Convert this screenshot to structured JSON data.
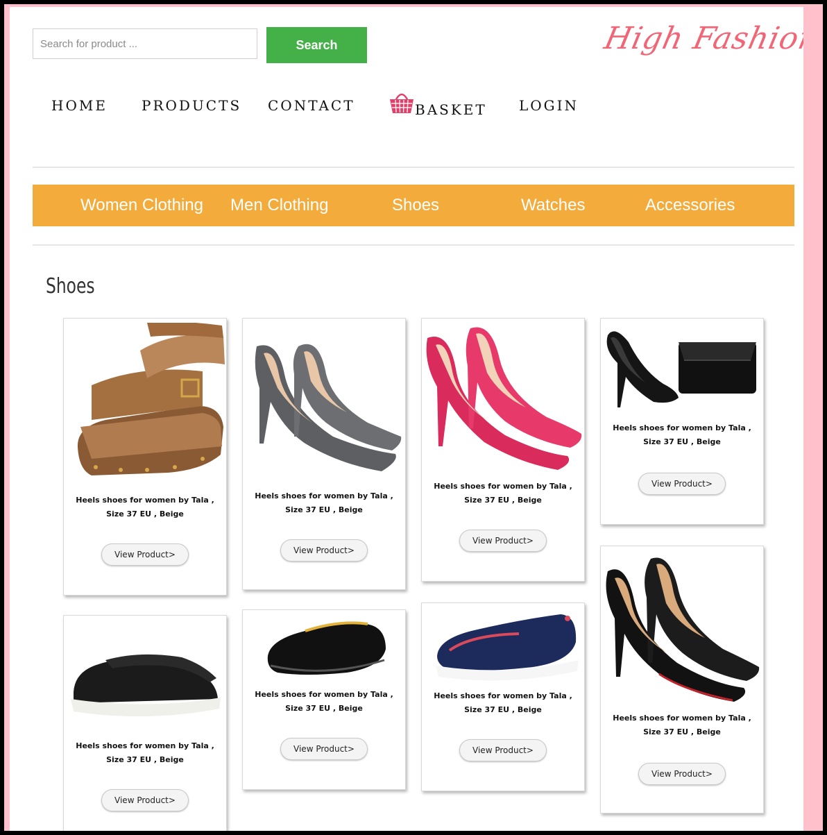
{
  "search": {
    "placeholder": "Search for product ...",
    "button_label": "Search"
  },
  "logo": {
    "text": "High Fashion"
  },
  "nav": {
    "home": "HOME",
    "products": "PRODUCTS",
    "contact": "CONTACT",
    "basket": "BASKET",
    "login": "LOGIN"
  },
  "categories": [
    "Women Clothing",
    "Men Clothing",
    "Shoes",
    "Watches",
    "Accessories"
  ],
  "section_title": "Shoes",
  "products": [
    {
      "description": "Heels shoes for women by Tala , Size 37 EU , Beige",
      "button": "View Product>",
      "image": "brown-wedge-sandal"
    },
    {
      "description": "Heels shoes for women by Tala , Size 37 EU , Beige",
      "button": "View Product>",
      "image": "grey-suede-pump"
    },
    {
      "description": "Heels shoes for women by Tala , Size 37 EU , Beige",
      "button": "View Product>",
      "image": "pink-patent-pump"
    },
    {
      "description": "Heels shoes for women by Tala , Size 37 EU , Beige",
      "button": "View Product>",
      "image": "black-heel-with-clutch"
    },
    {
      "description": "Heels shoes for women by Tala , Size 37 EU , Beige",
      "button": "View Product>",
      "image": "black-sneaker"
    },
    {
      "description": "Heels shoes for women by Tala , Size 37 EU , Beige",
      "button": "View Product>",
      "image": "black-slip-on"
    },
    {
      "description": "Heels shoes for women by Tala , Size 37 EU , Beige",
      "button": "View Product>",
      "image": "navy-slip-on"
    },
    {
      "description": "Heels shoes for women by Tala , Size 37 EU , Beige",
      "button": "View Product>",
      "image": "black-patent-pump"
    }
  ],
  "colors": {
    "frame": "#ffc0cb",
    "search_button": "#43b148",
    "category_bar": "#f3ac3c",
    "logo": "#f06677",
    "basket_icon": "#e0406a"
  }
}
